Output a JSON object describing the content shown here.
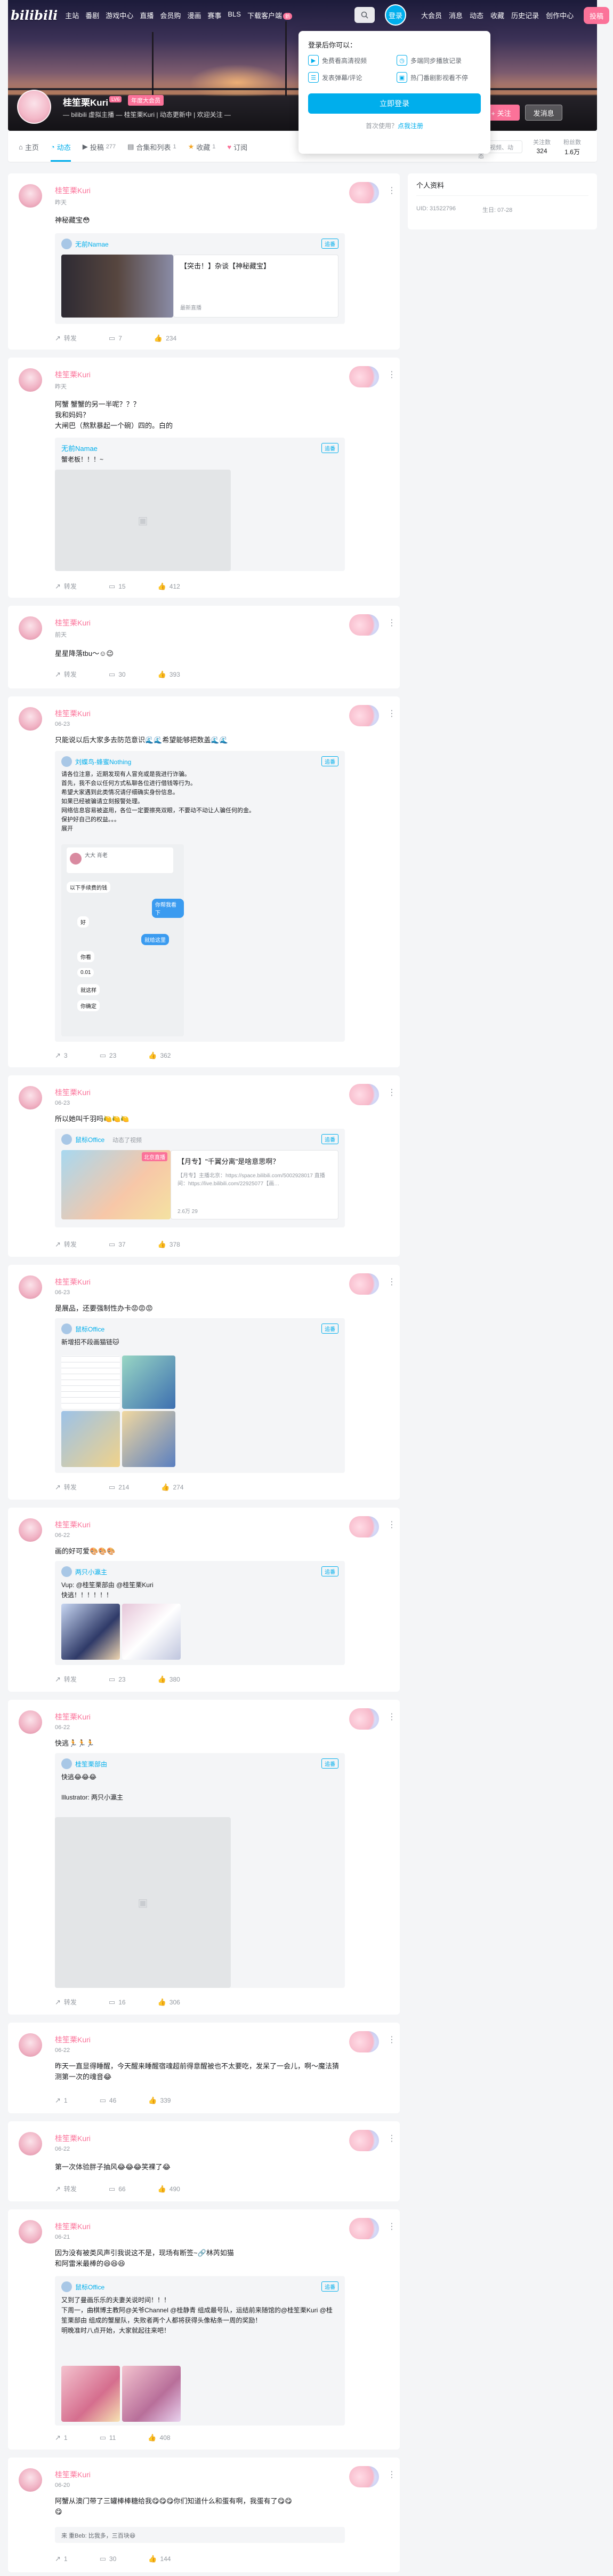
{
  "header": {
    "logo": "bilibili",
    "nav_left": [
      "主站",
      "番剧",
      "游戏中心",
      "直播",
      "会员购",
      "漫画",
      "赛事",
      "BLS",
      "下载客户端"
    ],
    "download_badge": "新",
    "login": "登录",
    "nav_right": [
      "大会员",
      "消息",
      "动态",
      "收藏",
      "历史记录",
      "创作中心"
    ],
    "post": "投稿"
  },
  "login_popup": {
    "title": "登录后你可以：",
    "items": [
      "免费看高清视频",
      "多端同步播放记录",
      "发表弹幕/评论",
      "热门番剧影视看不停"
    ],
    "button": "立即登录",
    "register_prefix": "首次使用？",
    "register_link": "点我注册"
  },
  "profile": {
    "name": "桂笙栗Kuri",
    "level": "LV6",
    "vip": "年度大会员",
    "sign": "— bilibili 虚拟主播 — 桂笙栗Kuri | 动态更新中 | 欢迎关注 —",
    "follow": "+ 关注",
    "message": "发消息"
  },
  "tabs": [
    {
      "label": "主页",
      "count": ""
    },
    {
      "label": "动态",
      "count": ""
    },
    {
      "label": "投稿",
      "count": "277"
    },
    {
      "label": "合集和列表",
      "count": "1"
    },
    {
      "label": "收藏",
      "count": "1"
    },
    {
      "label": "订阅",
      "count": ""
    }
  ],
  "tab_search_placeholder": "搜索视频、动态",
  "stats": [
    {
      "label": "关注数",
      "value": "324"
    },
    {
      "label": "粉丝数",
      "value": "1.6万"
    }
  ],
  "sidebar": {
    "title": "个人资料",
    "uid": "UID: 31522796",
    "birthday": "生日: 07-28"
  },
  "posts": [
    {
      "time": "昨天",
      "text": "神秘藏宝😳",
      "forward": {
        "user": "无前Namae",
        "tag": "追番"
      },
      "video": {
        "title": "【突击！】杂谈【神秘藏宝】",
        "sub": "最新直播"
      },
      "actions": {
        "share": "转发",
        "comment": "7",
        "like": "234"
      }
    },
    {
      "time": "昨天",
      "text": "阿蟹 蟹蟹的另一半呢？？？\n我和妈妈？\n大闸巴（熬默暴起一个碗）四的。白的",
      "forward": {
        "user": "无前Namae",
        "tag": "追番",
        "text": "蟹老板！！！~"
      },
      "actions": {
        "share": "转发",
        "comment": "15",
        "like": "412"
      }
    },
    {
      "time": "前天",
      "text": "星星降落tbu～☺😉",
      "actions": {
        "share": "转发",
        "comment": "30",
        "like": "393"
      }
    },
    {
      "time": "06-23",
      "text": "只能说以后大家多去防范意识🌊🌊希望能够把数盖🌊🌊",
      "forward": {
        "user": "刘蝶鸟-蜂蜜Nothing",
        "tag": "追番",
        "text": "请各位注意，近期发现有人冒充或是我进行诈骗。\n首先，我不会以任何方式私聊各位进行借钱等行为。\n希望大家遇到此类情况请仔细确实身份信息。\n如果已经被骗请立刻报警处理。\n网络信息容易被盗用，各位一定要擦亮双眼，不要动不动让人骗任何的金。\n保护好自己的权益。。。\n展开"
      },
      "chat": [
        "大大 肖老",
        "以下手续费的钱",
        "你帮我看下",
        "好",
        "就给这里",
        "你看",
        "0.01",
        "就这样",
        "你确定"
      ],
      "actions": {
        "share": "3",
        "comment": "23",
        "like": "362"
      }
    },
    {
      "time": "06-23",
      "text": "所以她叫千羽吗🍋🍋🍋",
      "forward": {
        "user": "鼠标Office",
        "sub": "动态了视频",
        "tag": "追番"
      },
      "video": {
        "title": "【月专】\"千翼分离\"是啥意思啊？",
        "desc": "【月专】主播北京：https://space.bilibili.com/5002928017 直播间：https://live.bilibili.com/22925077【画…",
        "meta": "2.6万   29",
        "cover_label": "北京直播"
      },
      "actions": {
        "share": "转发",
        "comment": "37",
        "like": "378"
      }
    },
    {
      "time": "06-23",
      "text": "是展品，还要强制性办卡😡😡😡",
      "forward": {
        "user": "鼠标Office",
        "tag": "追番",
        "text": "新增招不段画猫链🐱"
      },
      "actions": {
        "share": "转发",
        "comment": "214",
        "like": "274"
      }
    },
    {
      "time": "06-22",
      "text": "画的好可爱🎨🎨🎨",
      "forward": {
        "user": "两只小瀛主",
        "tag": "追番",
        "text": "Vup: @桂笙栗部由 @桂笙栗Kuri\n快逃！！！！！！"
      },
      "actions": {
        "share": "转发",
        "comment": "23",
        "like": "380"
      }
    },
    {
      "time": "06-22",
      "text": "快逃🏃🏃🏃",
      "forward": {
        "user": "桂笙栗部由",
        "tag": "追番",
        "text": "快逃😂😂😂\n\nIllustrator: 两只小瀛主"
      },
      "actions": {
        "share": "转发",
        "comment": "16",
        "like": "306"
      }
    },
    {
      "time": "06-22",
      "text": "昨天一直显得睡醒，今天醒来睡醒宿魂超前得意醒被也不太要吃，发呆了一会儿，啊～魔法猜测第一次的魂音😂",
      "actions": {
        "share": "1",
        "comment": "46",
        "like": "339"
      }
    },
    {
      "time": "06-22",
      "text": "第一次体验胖子抽风😂😂😂笑裸了😂",
      "actions": {
        "share": "转发",
        "comment": "66",
        "like": "490"
      }
    },
    {
      "time": "06-21",
      "text": "因为没有被类风声引我说这不是，现场有断签~🔗林芮如猫\n和阿雷米最棒的😆😆😆",
      "forward": {
        "user": "鼠标Office",
        "tag": "追番",
        "text": "又到了曼画乐乐的夫妻关说时间！！！\n下周一，曲棋博主教阿@关爷Channel @桂静青 组成最号队，运结前来随馆的@桂笙栗Kuri @桂笙栗部由 组成的蟹屋队，失败者两个人都将获得头像粘条一周的奖励！\n明晚准时八点开始，大家就起往来吧！"
      },
      "actions": {
        "share": "1",
        "comment": "11",
        "like": "408"
      }
    },
    {
      "time": "06-20",
      "text": "阿蟹从澳门带了三罐棒棒糖给我😋😋😋你们知道什么和蛋有啊，我蛋有了😋😋\n😋",
      "reply": "来 重Beb: 比我多，三百块😆",
      "actions": {
        "share": "1",
        "comment": "30",
        "like": "144"
      }
    }
  ]
}
